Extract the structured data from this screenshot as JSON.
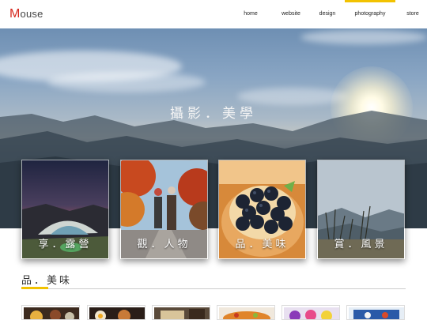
{
  "header": {
    "logo": {
      "initial": "M",
      "rest": "ouse"
    },
    "nav": [
      {
        "label": "home",
        "active": false
      },
      {
        "label": "website",
        "active": false
      },
      {
        "label": "design",
        "active": false
      },
      {
        "label": "photography",
        "active": true
      },
      {
        "label": "store",
        "active": false
      }
    ],
    "accent_color": "#f2c200"
  },
  "hero": {
    "title": "攝影．美學"
  },
  "categories": [
    {
      "label": "享．露營"
    },
    {
      "label": "觀．人物"
    },
    {
      "label": "品．美味"
    },
    {
      "label": "賞．風景"
    }
  ],
  "section": {
    "title": "品．美味"
  },
  "thumbnails": [
    {
      "subject": "food-photo"
    },
    {
      "subject": "food-photo"
    },
    {
      "subject": "food-photo"
    },
    {
      "subject": "food-photo"
    },
    {
      "subject": "food-photo"
    },
    {
      "subject": "food-photo"
    }
  ]
}
